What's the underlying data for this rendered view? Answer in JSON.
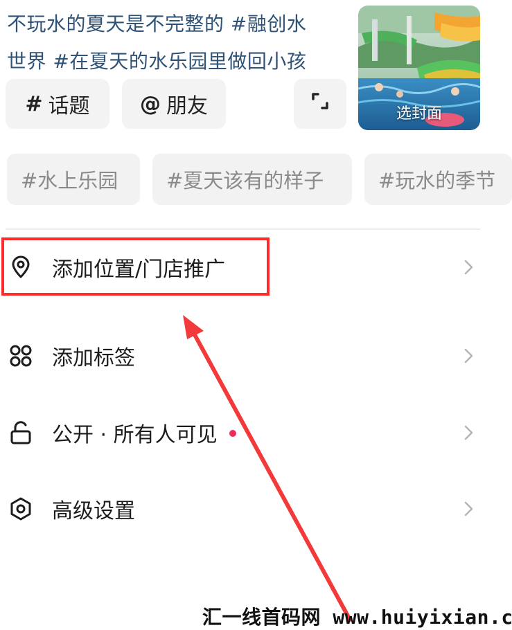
{
  "caption": {
    "line1": "不玩水的夏天是不完整的 #融创水",
    "line2": "世界 #在夏天的水乐园里做回小孩"
  },
  "chips": {
    "topic_symbol": "#",
    "topic_label": "话题",
    "friend_symbol": "@",
    "friend_label": "朋友"
  },
  "cover": {
    "label": "选封面"
  },
  "suggested_tags": [
    "#水上乐园",
    "#夏天该有的样子",
    "#玩水的季节"
  ],
  "menu": {
    "location": "添加位置/门店推广",
    "tags": "添加标签",
    "privacy": "公开 · 所有人可见",
    "advanced": "高级设置"
  },
  "colors": {
    "caption_text": "#2f5277",
    "highlight": "#ff2a2a",
    "notify_dot": "#ee2c55"
  },
  "watermark": "汇一线首码网 www.huiyixian.com"
}
